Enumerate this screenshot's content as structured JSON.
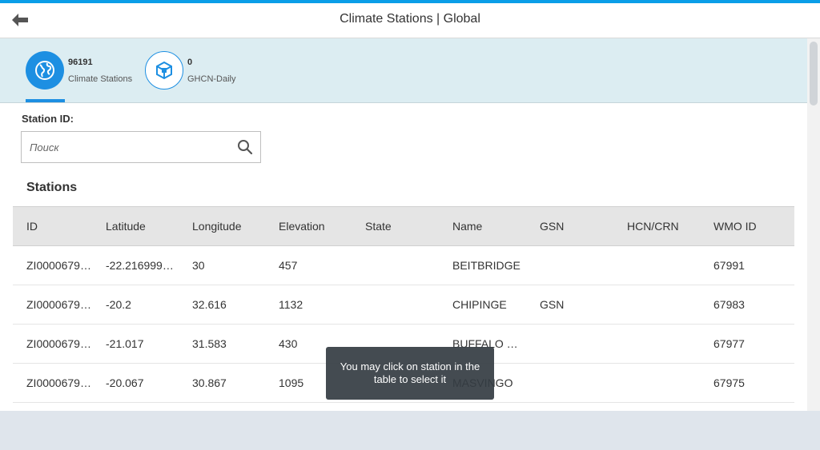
{
  "shell": {
    "title": "Climate Stations | Global",
    "back_icon": "arrow-left-icon"
  },
  "header": {
    "tabs": [
      {
        "count": "96191",
        "label": "Climate Stations",
        "icon": "globe-icon",
        "selected": true
      },
      {
        "count": "0",
        "label": "GHCN-Daily",
        "icon": "cube-icon",
        "selected": false
      }
    ]
  },
  "filter": {
    "label": "Station ID:",
    "placeholder": "Поиск",
    "value": ""
  },
  "table": {
    "title": "Stations",
    "columns": [
      "ID",
      "Latitude",
      "Longitude",
      "Elevation",
      "State",
      "Name",
      "GSN",
      "HCN/CRN",
      "WMO ID"
    ],
    "rows": [
      [
        "ZI0000679…",
        "-22.216999…",
        "30",
        "457",
        "",
        "BEITBRIDGE",
        "",
        "",
        "67991"
      ],
      [
        "ZI0000679…",
        "-20.2",
        "32.616",
        "1132",
        "",
        "CHIPINGE",
        "GSN",
        "",
        "67983"
      ],
      [
        "ZI0000679…",
        "-21.017",
        "31.583",
        "430",
        "",
        "BUFFALO …",
        "",
        "",
        "67977"
      ],
      [
        "ZI0000679…",
        "-20.067",
        "30.867",
        "1095",
        "",
        "MASVINGO",
        "",
        "",
        "67975"
      ]
    ]
  },
  "tooltip": {
    "text": "You may click on station in the table to select it"
  },
  "colors": {
    "accent": "#1d8fe2",
    "top_bar": "#0a9ee8",
    "header_bg": "#dcedf2"
  }
}
